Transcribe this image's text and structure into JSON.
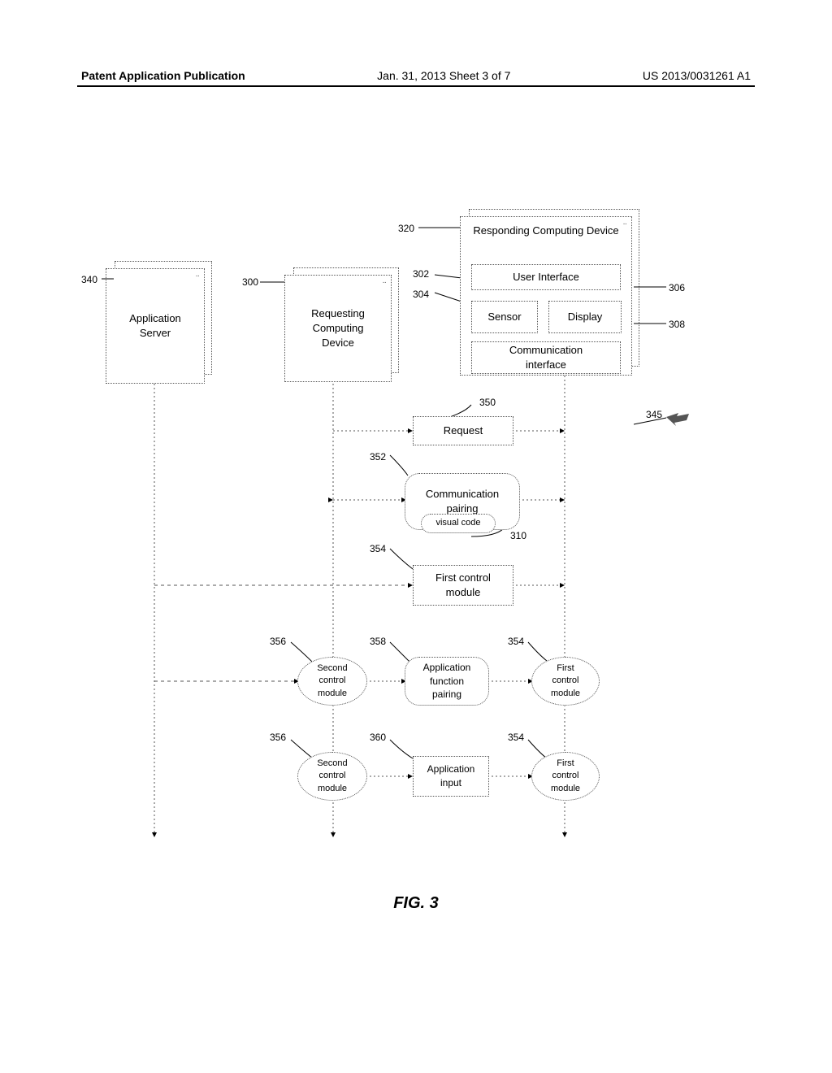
{
  "header": {
    "left": "Patent Application Publication",
    "center": "Jan. 31, 2013  Sheet 3 of 7",
    "right": "US 2013/0031261 A1"
  },
  "figure_label": "FIG. 3",
  "boxes": {
    "app_server": "Application\nServer",
    "requesting_device": "Requesting\nComputing\nDevice",
    "responding_device": "Responding Computing\nDevice",
    "user_interface": "User Interface",
    "sensor": "Sensor",
    "display": "Display",
    "comm_interface": "Communication\ninterface",
    "request": "Request",
    "comm_pairing": "Communication\npairing",
    "visual_code": "visual code",
    "first_control": "First control\nmodule",
    "app_func_pairing": "Application\nfunction\npairing",
    "second_control": "Second\ncontrol\nmodule",
    "first_control_small": "First\ncontrol\nmodule",
    "app_input": "Application\ninput"
  },
  "refs": {
    "r320": "320",
    "r300": "300",
    "r340": "340",
    "r302": "302",
    "r304": "304",
    "r306": "306",
    "r308": "308",
    "r310": "310",
    "r345": "345",
    "r350": "350",
    "r352": "352",
    "r354": "354",
    "r356": "356",
    "r358": "358",
    "r360": "360"
  }
}
